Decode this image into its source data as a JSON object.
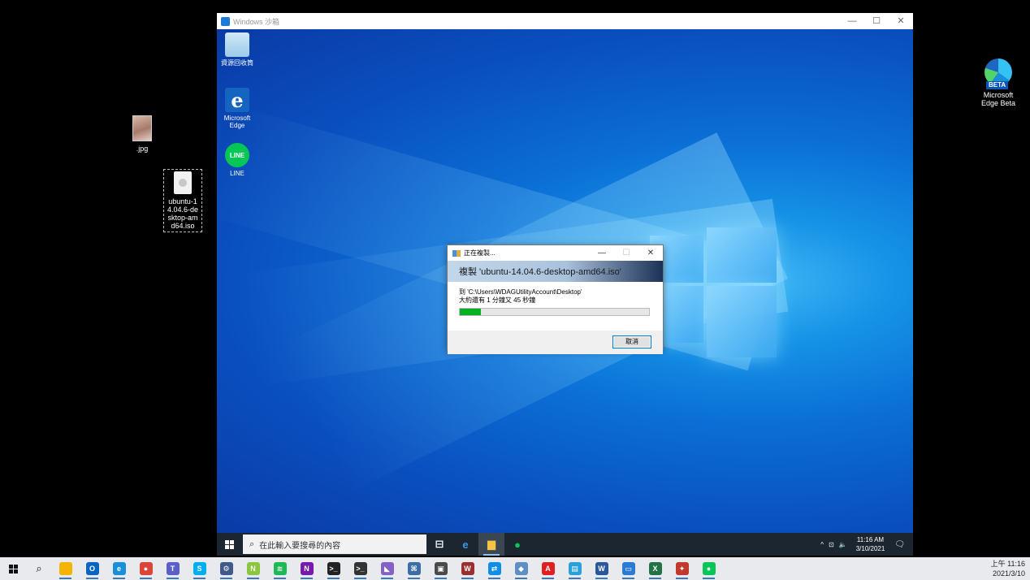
{
  "host_desktop": {
    "icons": [
      {
        "label": ".jpg"
      },
      {
        "label": "ubuntu-14.04.6-desktop-amd64.iso"
      },
      {
        "label": "Microsoft Edge Beta",
        "badge": "BETA"
      }
    ]
  },
  "sandbox": {
    "title": "Windows 沙箱",
    "controls": {
      "minimize": "—",
      "maximize": "☐",
      "close": "✕"
    },
    "desktop_icons": [
      {
        "label": "資源回收筒",
        "icon": "recycle-bin-icon"
      },
      {
        "label": "Microsoft Edge",
        "icon": "edge-icon",
        "glyph": "e"
      },
      {
        "label": "LINE",
        "icon": "line-icon",
        "glyph": "LINE"
      }
    ],
    "dialog": {
      "title": "正在複製...",
      "heading": "複製 'ubuntu-14.04.6-desktop-amd64.iso'",
      "destination": "到 'C:\\Users\\WDAGUtilityAccount\\Desktop'",
      "remaining": "大約還有 1 分鐘又 45 秒鐘",
      "progress_percent": 11,
      "cancel_label": "取消",
      "controls": {
        "minimize": "—",
        "maximize": "☐",
        "close": "✕"
      }
    },
    "taskbar": {
      "search_placeholder": "在此輸入要搜尋的內容",
      "apps": [
        {
          "name": "task-view",
          "glyph": "⊟",
          "color": "#ffffff"
        },
        {
          "name": "edge",
          "glyph": "e",
          "color": "#3b9be8"
        },
        {
          "name": "file-explorer",
          "glyph": "▆",
          "color": "#f4c542",
          "active": true
        },
        {
          "name": "line",
          "glyph": "●",
          "color": "#06c755"
        }
      ],
      "tray": {
        "chevron": "^",
        "network": "⊡",
        "volume": "🔈",
        "notifications": "🗨"
      },
      "time": "11:16 AM",
      "date": "3/10/2021"
    }
  },
  "host_taskbar": {
    "apps": [
      {
        "name": "file-explorer",
        "color": "#f4b400",
        "glyph": ""
      },
      {
        "name": "outlook",
        "color": "#0a64c2",
        "glyph": "O"
      },
      {
        "name": "edge",
        "color": "#1a8fd9",
        "glyph": "e"
      },
      {
        "name": "chrome",
        "color": "#db4437",
        "glyph": "●"
      },
      {
        "name": "teams",
        "color": "#5b5fc7",
        "glyph": "T"
      },
      {
        "name": "skype",
        "color": "#00aff0",
        "glyph": "S"
      },
      {
        "name": "remote-app",
        "color": "#3f5a8a",
        "glyph": "⚙"
      },
      {
        "name": "notepad-plus",
        "color": "#8cc63f",
        "glyph": "N"
      },
      {
        "name": "spotify",
        "color": "#1db954",
        "glyph": "≋"
      },
      {
        "name": "onenote",
        "color": "#7719aa",
        "glyph": "N"
      },
      {
        "name": "terminal",
        "color": "#222222",
        "glyph": ">_"
      },
      {
        "name": "cmd",
        "color": "#333333",
        "glyph": ">_"
      },
      {
        "name": "visual-studio",
        "color": "#8661c5",
        "glyph": "◣"
      },
      {
        "name": "network-tool",
        "color": "#3a6ea5",
        "glyph": "⌘"
      },
      {
        "name": "image-viewer",
        "color": "#4a4a4a",
        "glyph": "▣"
      },
      {
        "name": "winrar",
        "color": "#9b2f2f",
        "glyph": "W"
      },
      {
        "name": "teamviewer",
        "color": "#0e8ee9",
        "glyph": "⇄"
      },
      {
        "name": "sandbox-app",
        "color": "#5e8fc4",
        "glyph": "◆"
      },
      {
        "name": "acrobat",
        "color": "#e02020",
        "glyph": "A"
      },
      {
        "name": "package-app",
        "color": "#2aa0d8",
        "glyph": "▤"
      },
      {
        "name": "word",
        "color": "#2b579a",
        "glyph": "W"
      },
      {
        "name": "windows-sandbox",
        "color": "#2a7bd3",
        "glyph": "▭"
      },
      {
        "name": "excel",
        "color": "#217346",
        "glyph": "X"
      },
      {
        "name": "pin-app",
        "color": "#c0392b",
        "glyph": "✦"
      },
      {
        "name": "line",
        "color": "#06c755",
        "glyph": "●"
      }
    ],
    "time": "上午 11:16",
    "date": "2021/3/10"
  }
}
